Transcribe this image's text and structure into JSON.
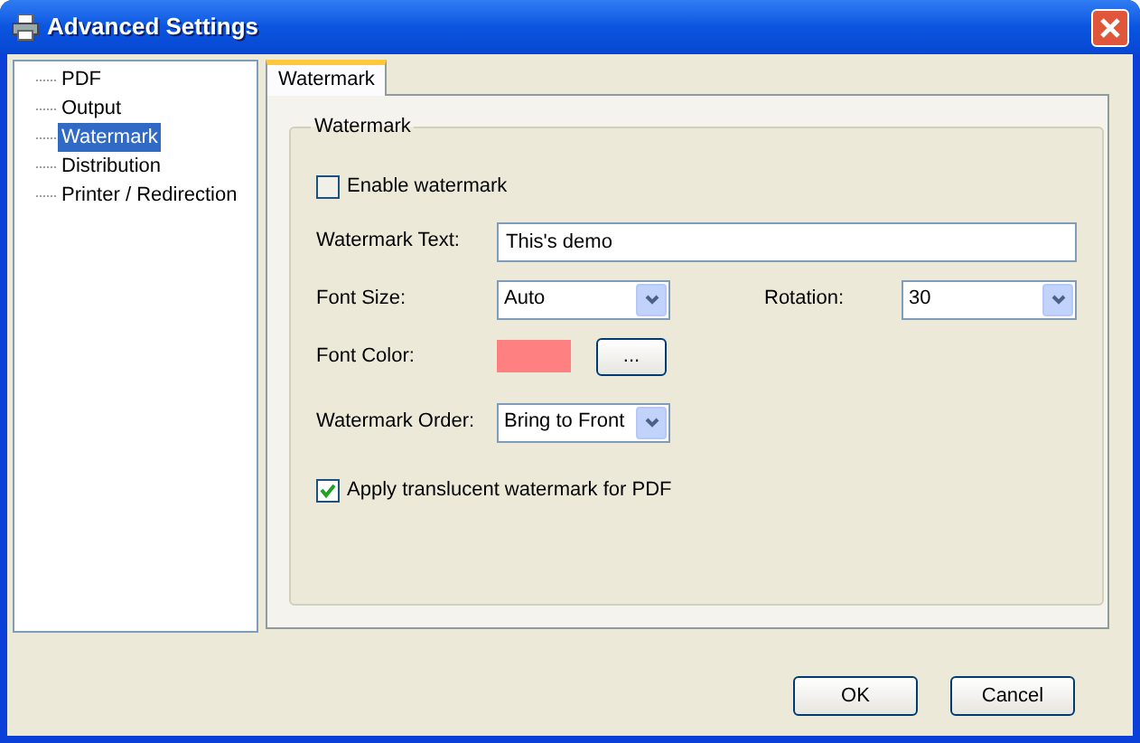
{
  "window": {
    "title": "Advanced Settings"
  },
  "tree": [
    {
      "label": "PDF",
      "selected": false
    },
    {
      "label": "Output",
      "selected": false
    },
    {
      "label": "Watermark",
      "selected": true
    },
    {
      "label": "Distribution",
      "selected": false
    },
    {
      "label": "Printer / Redirection",
      "selected": false
    }
  ],
  "tabs": [
    {
      "label": "Watermark",
      "selected": true
    }
  ],
  "group": {
    "title": "Watermark",
    "enable_watermark": {
      "label": "Enable watermark",
      "checked": false
    },
    "watermark_text": {
      "label": "Watermark Text:",
      "value": "This's demo"
    },
    "font_size": {
      "label": "Font Size:",
      "value": "Auto"
    },
    "rotation": {
      "label": "Rotation:",
      "value": "30"
    },
    "font_color": {
      "label": "Font Color:",
      "color": "#ff8080",
      "button": "..."
    },
    "watermark_order": {
      "label": "Watermark Order:",
      "value": "Bring to Front"
    },
    "translucent": {
      "label": "Apply translucent watermark for PDF",
      "checked": true
    }
  },
  "buttons": [
    {
      "label": "OK"
    },
    {
      "label": "Cancel"
    }
  ]
}
